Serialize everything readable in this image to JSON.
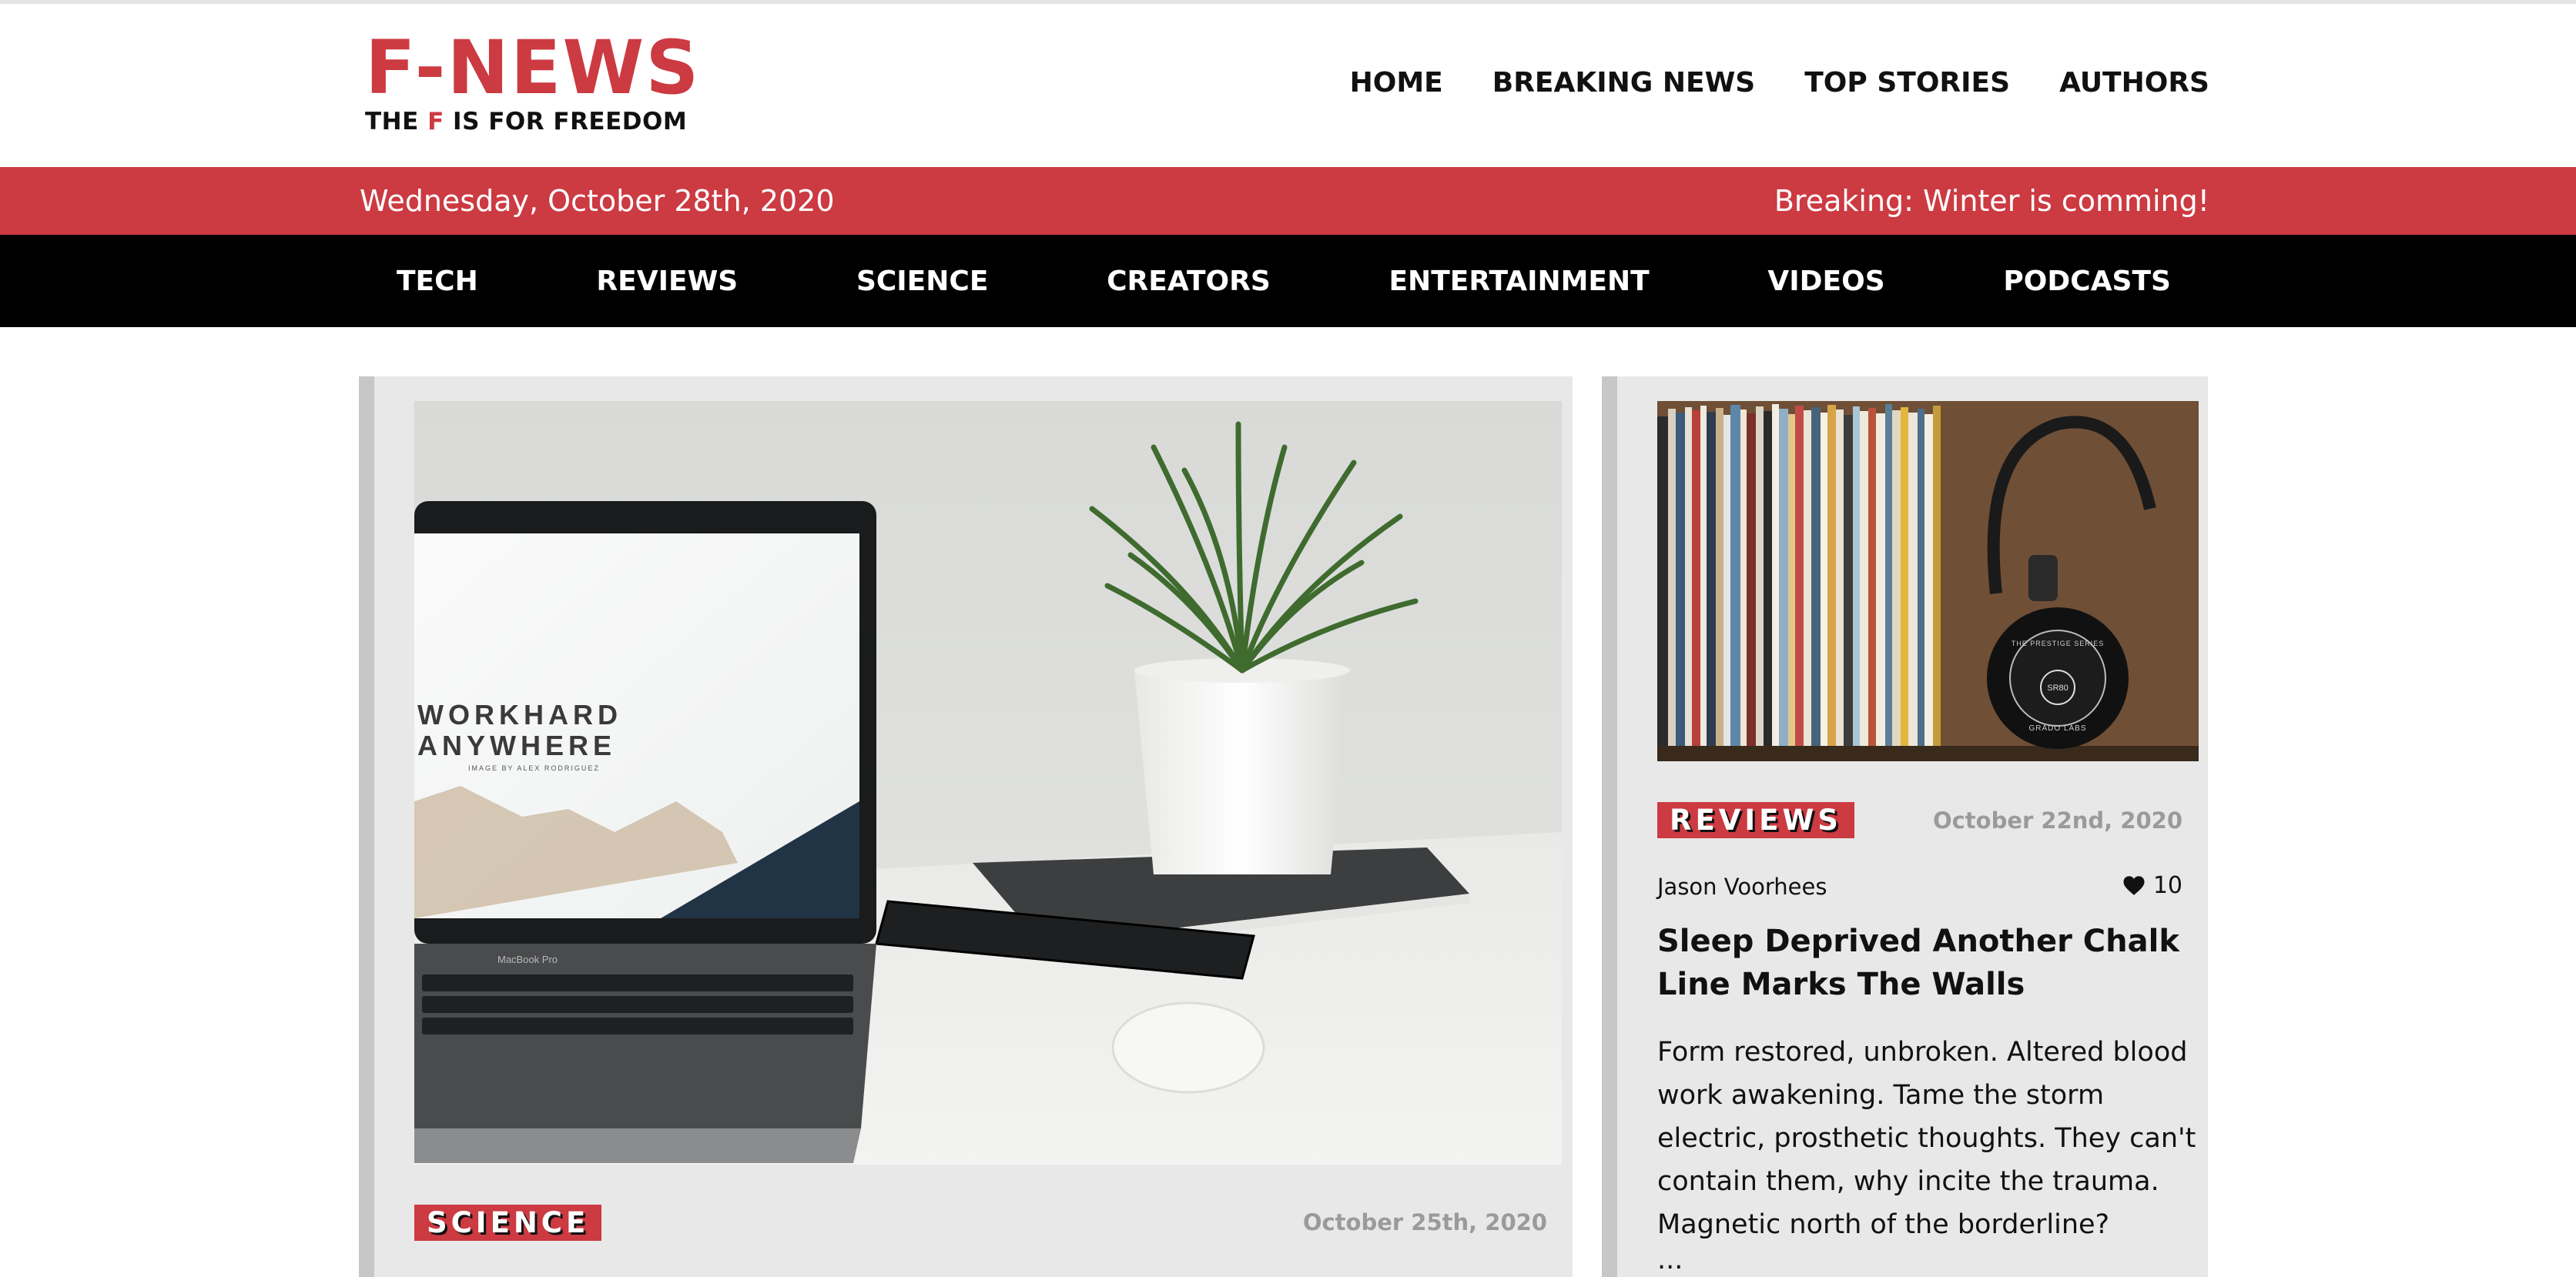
{
  "brand": {
    "name": "F-NEWS",
    "tagline_prefix": "THE ",
    "tagline_highlight": "F",
    "tagline_suffix": " IS FOR FREEDOM"
  },
  "top_nav": [
    "HOME",
    "BREAKING NEWS",
    "TOP STORIES",
    "AUTHORS"
  ],
  "info_bar": {
    "date": "Wednesday, October 28th, 2020",
    "breaking": "Breaking: Winter is comming!"
  },
  "categories": [
    "TECH",
    "REVIEWS",
    "SCIENCE",
    "CREATORS",
    "ENTERTAINMENT",
    "VIDEOS",
    "PODCASTS"
  ],
  "main_article": {
    "image": {
      "screen_line1": "WORKHARD",
      "screen_line2": "ANYWHERE",
      "screen_credit": "IMAGE BY ALEX RODRIGUEZ",
      "laptop_label": "MacBook Pro"
    },
    "category": "SCIENCE",
    "date": "October 25th, 2020"
  },
  "side_article": {
    "image": {
      "headphone_brand": "GRADO LABS",
      "headphone_series": "THE PRESTIGE SERIES",
      "headphone_model": "SR80"
    },
    "category": "REVIEWS",
    "date": "October 22nd, 2020",
    "author": "Jason Voorhees",
    "likes": "10",
    "title": "Sleep Deprived Another Chalk Line Marks The Walls",
    "excerpt": "Form restored, unbroken. Altered blood work awakening. Tame the storm electric, prosthetic thoughts. They can't contain them, why incite the trauma. Magnetic north of the borderline?",
    "ellipsis": "..."
  },
  "colors": {
    "accent": "#cc3a42",
    "nav_bg": "#000000",
    "card_bg": "#e8e8e8",
    "card_border": "#c7c7c7",
    "date_text": "#9a9a9a"
  },
  "icons": [
    "heart-icon"
  ]
}
